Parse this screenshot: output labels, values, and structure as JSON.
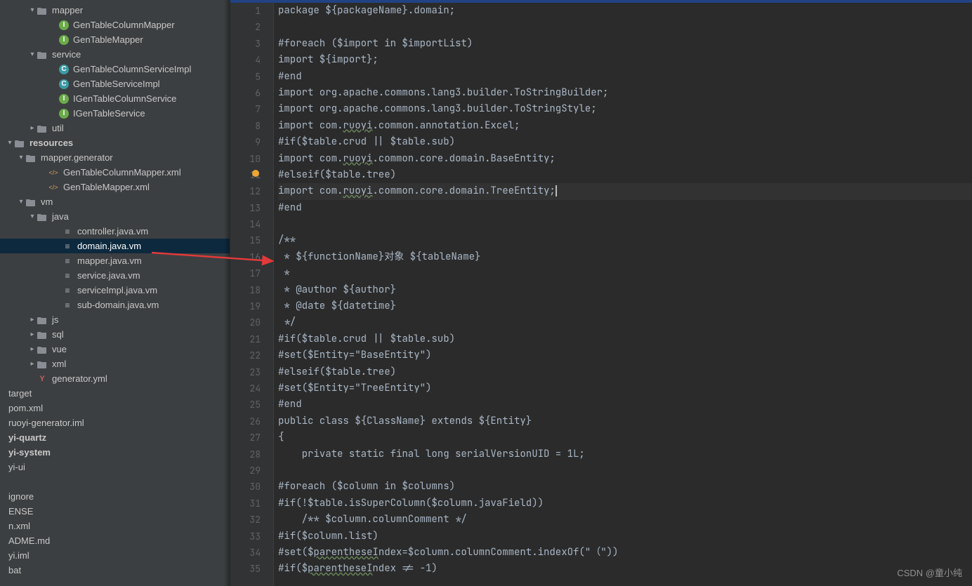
{
  "tree": [
    {
      "indent": 40,
      "chev": "down",
      "icon": "folder",
      "label": "mapper"
    },
    {
      "indent": 72,
      "chev": "",
      "icon": "i-green",
      "label": "GenTableColumnMapper"
    },
    {
      "indent": 72,
      "chev": "",
      "icon": "i-green",
      "label": "GenTableMapper"
    },
    {
      "indent": 40,
      "chev": "down",
      "icon": "folder",
      "label": "service"
    },
    {
      "indent": 72,
      "chev": "",
      "icon": "c-teal",
      "label": "GenTableColumnServiceImpl"
    },
    {
      "indent": 72,
      "chev": "",
      "icon": "c-teal",
      "label": "GenTableServiceImpl"
    },
    {
      "indent": 72,
      "chev": "",
      "icon": "i-green",
      "label": "IGenTableColumnService"
    },
    {
      "indent": 72,
      "chev": "",
      "icon": "i-green",
      "label": "IGenTableService"
    },
    {
      "indent": 40,
      "chev": "right",
      "icon": "folder",
      "label": "util"
    },
    {
      "indent": 8,
      "chev": "down",
      "icon": "folder",
      "label": "resources",
      "bold": true
    },
    {
      "indent": 24,
      "chev": "down",
      "icon": "folder",
      "label": "mapper.generator"
    },
    {
      "indent": 56,
      "chev": "",
      "icon": "xml",
      "label": "GenTableColumnMapper.xml"
    },
    {
      "indent": 56,
      "chev": "",
      "icon": "xml",
      "label": "GenTableMapper.xml"
    },
    {
      "indent": 24,
      "chev": "down",
      "icon": "folder",
      "label": "vm"
    },
    {
      "indent": 40,
      "chev": "down",
      "icon": "folder",
      "label": "java"
    },
    {
      "indent": 76,
      "chev": "",
      "icon": "file",
      "label": "controller.java.vm"
    },
    {
      "indent": 76,
      "chev": "",
      "icon": "file",
      "label": "domain.java.vm",
      "selected": true
    },
    {
      "indent": 76,
      "chev": "",
      "icon": "file",
      "label": "mapper.java.vm"
    },
    {
      "indent": 76,
      "chev": "",
      "icon": "file",
      "label": "service.java.vm"
    },
    {
      "indent": 76,
      "chev": "",
      "icon": "file",
      "label": "serviceImpl.java.vm"
    },
    {
      "indent": 76,
      "chev": "",
      "icon": "file",
      "label": "sub-domain.java.vm"
    },
    {
      "indent": 40,
      "chev": "right",
      "icon": "folder",
      "label": "js"
    },
    {
      "indent": 40,
      "chev": "right",
      "icon": "folder",
      "label": "sql"
    },
    {
      "indent": 40,
      "chev": "right",
      "icon": "folder",
      "label": "vue"
    },
    {
      "indent": 40,
      "chev": "right",
      "icon": "folder",
      "label": "xml"
    },
    {
      "indent": 40,
      "chev": "",
      "icon": "yml",
      "label": "generator.yml"
    },
    {
      "indent": 0,
      "chev": "",
      "icon": "",
      "label": "target"
    },
    {
      "indent": 0,
      "chev": "",
      "icon": "",
      "label": "pom.xml"
    },
    {
      "indent": 0,
      "chev": "",
      "icon": "",
      "label": "ruoyi-generator.iml"
    },
    {
      "indent": 0,
      "chev": "",
      "icon": "",
      "label": "yi-quartz",
      "bold": true
    },
    {
      "indent": 0,
      "chev": "",
      "icon": "",
      "label": "yi-system",
      "bold": true
    },
    {
      "indent": 0,
      "chev": "",
      "icon": "",
      "label": "yi-ui"
    },
    {
      "indent": 0,
      "chev": "",
      "icon": "",
      "label": "",
      "blank": true
    },
    {
      "indent": 0,
      "chev": "",
      "icon": "",
      "label": "ignore"
    },
    {
      "indent": 0,
      "chev": "",
      "icon": "",
      "label": "ENSE"
    },
    {
      "indent": 0,
      "chev": "",
      "icon": "",
      "label": "n.xml"
    },
    {
      "indent": 0,
      "chev": "",
      "icon": "",
      "label": "ADME.md"
    },
    {
      "indent": 0,
      "chev": "",
      "icon": "",
      "label": "yi.iml"
    },
    {
      "indent": 0,
      "chev": "",
      "icon": "",
      "label": "bat"
    }
  ],
  "code": {
    "lines": [
      "package ${packageName}.domain;",
      "",
      "#foreach ($import in $importList)",
      "import ${import};",
      "#end",
      "import org.apache.commons.lang3.builder.ToStringBuilder;",
      "import org.apache.commons.lang3.builder.ToStringStyle;",
      "import com.[[ruoyi]].common.annotation.Excel;",
      "#if($table.crud || $table.sub)",
      "import com.[[ruoyi]].common.core.domain.BaseEntity;",
      "#elseif($table.tree)",
      "import com.[[ruoyi]].common.core.domain.TreeEntity;",
      "#end",
      "",
      "/**",
      " * ${functionName}对象 ${tableName}",
      " *",
      " * @author ${author}",
      " * @date ${datetime}",
      " */",
      "#if($table.crud || $table.sub)",
      "#set($Entity=\"BaseEntity\")",
      "#elseif($table.tree)",
      "#set($Entity=\"TreeEntity\")",
      "#end",
      "public class ${ClassName} extends ${Entity}",
      "{",
      "    private static final long serialVersionUID = 1L;",
      "",
      "#foreach ($column in $columns)",
      "#if(!$table.isSuperColumn($column.javaField))",
      "    /** $column.columnComment */",
      "#if($column.list)",
      "#set($[[parentheseI]]ndex=$column.columnComment.indexOf(\"（\"))",
      "#if($[[parentheseI]]ndex != -1)"
    ],
    "current_line_index": 11,
    "bulb_line_index": 10,
    "caret_after_line_index": 11
  },
  "watermark": "CSDN @童小纯"
}
